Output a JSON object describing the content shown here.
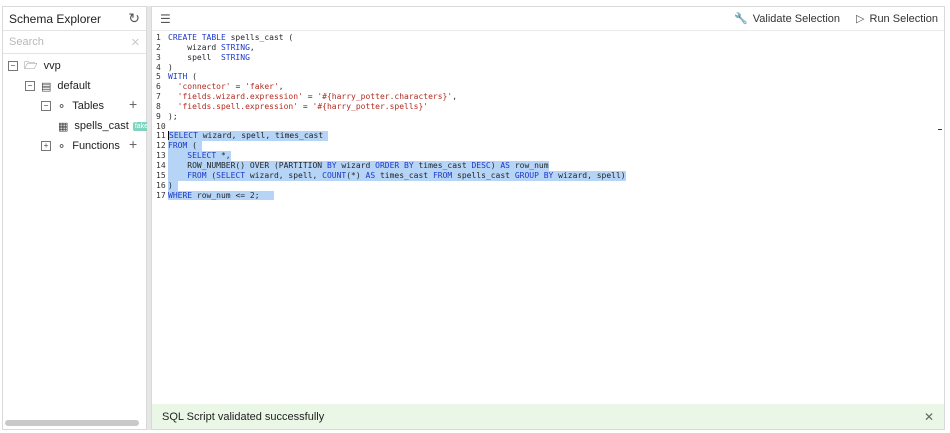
{
  "sidebar": {
    "title": "Schema Explorer",
    "refresh_icon": "refresh-icon",
    "search_placeholder": "Search",
    "tree": {
      "catalog": "vvp",
      "database": "default",
      "tables_label": "Tables",
      "table_name": "spells_cast",
      "table_tag": "faker",
      "functions_label": "Functions"
    }
  },
  "toolbar": {
    "validate_label": "Validate Selection",
    "run_label": "Run Selection"
  },
  "editor": {
    "line_numbers": [
      "1",
      "2",
      "3",
      "4",
      "5",
      "6",
      "7",
      "8",
      "9",
      "10",
      "11",
      "12",
      "13",
      "14",
      "15",
      "16",
      "17"
    ]
  },
  "status": {
    "message": "SQL Script validated successfully"
  },
  "colors": {
    "keyword": "#1c39c9",
    "string": "#b52a20",
    "selection": "#b6d4f5",
    "status_bg": "#eaf6e6",
    "tag": "#7fd3bf"
  }
}
